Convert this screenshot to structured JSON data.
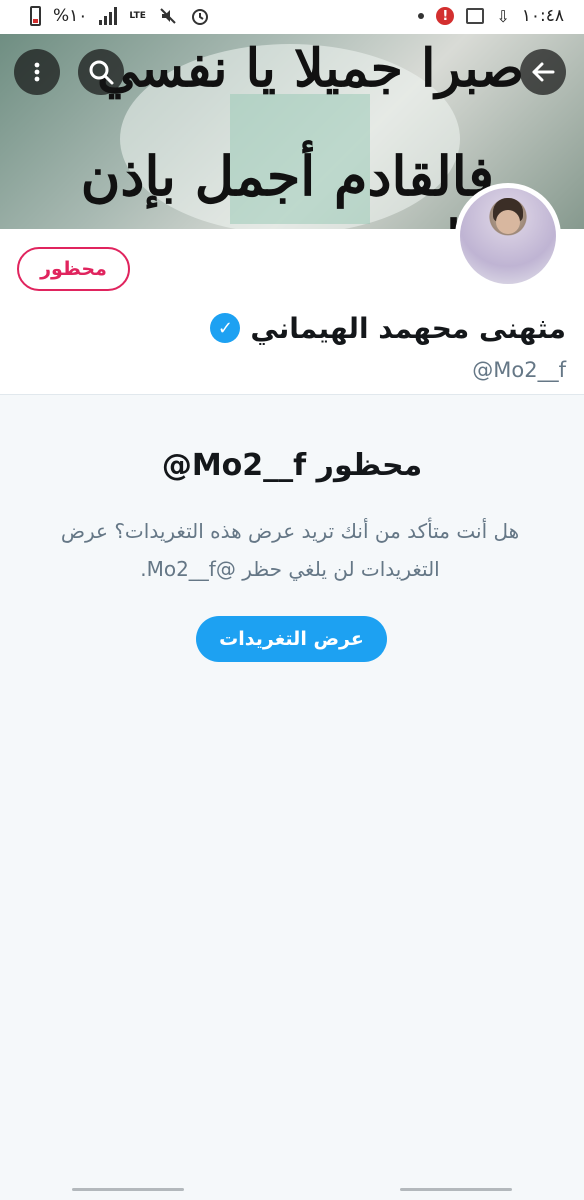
{
  "status_bar": {
    "battery_text": "%١٠",
    "network": "LTE",
    "time": "١٠:٤٨",
    "alert_badge": "!",
    "icons": [
      "battery-icon",
      "signal-icon",
      "lte-icon",
      "mute-icon",
      "alarm-icon",
      "dot-icon",
      "alert-icon",
      "image-icon",
      "download-icon"
    ]
  },
  "header": {
    "banner_line1": "صبرا جميلا يا نفسي",
    "banner_line2": "فالقادم أجمل بإذن الله",
    "icons": [
      "more-vertical-icon",
      "search-icon",
      "arrow-back-icon"
    ]
  },
  "profile": {
    "blocked_label": "محظور",
    "display_name": "مثهنى محهمد الهيماني",
    "handle": "@Mo2__f",
    "verified_mark": "✓"
  },
  "blocked_notice": {
    "title": "@Mo2__f محظور",
    "description": "هل أنت متأكد من أنك تريد عرض هذه التغريدات؟ عرض التغريدات لن يلغي حظر @Mo2__f.",
    "view_button": "عرض التغريدات"
  },
  "colors": {
    "accent": "#1da1f2",
    "blocked": "#e0245e",
    "text_primary": "#14171a",
    "text_secondary": "#657786",
    "background": "#f5f8fa"
  }
}
